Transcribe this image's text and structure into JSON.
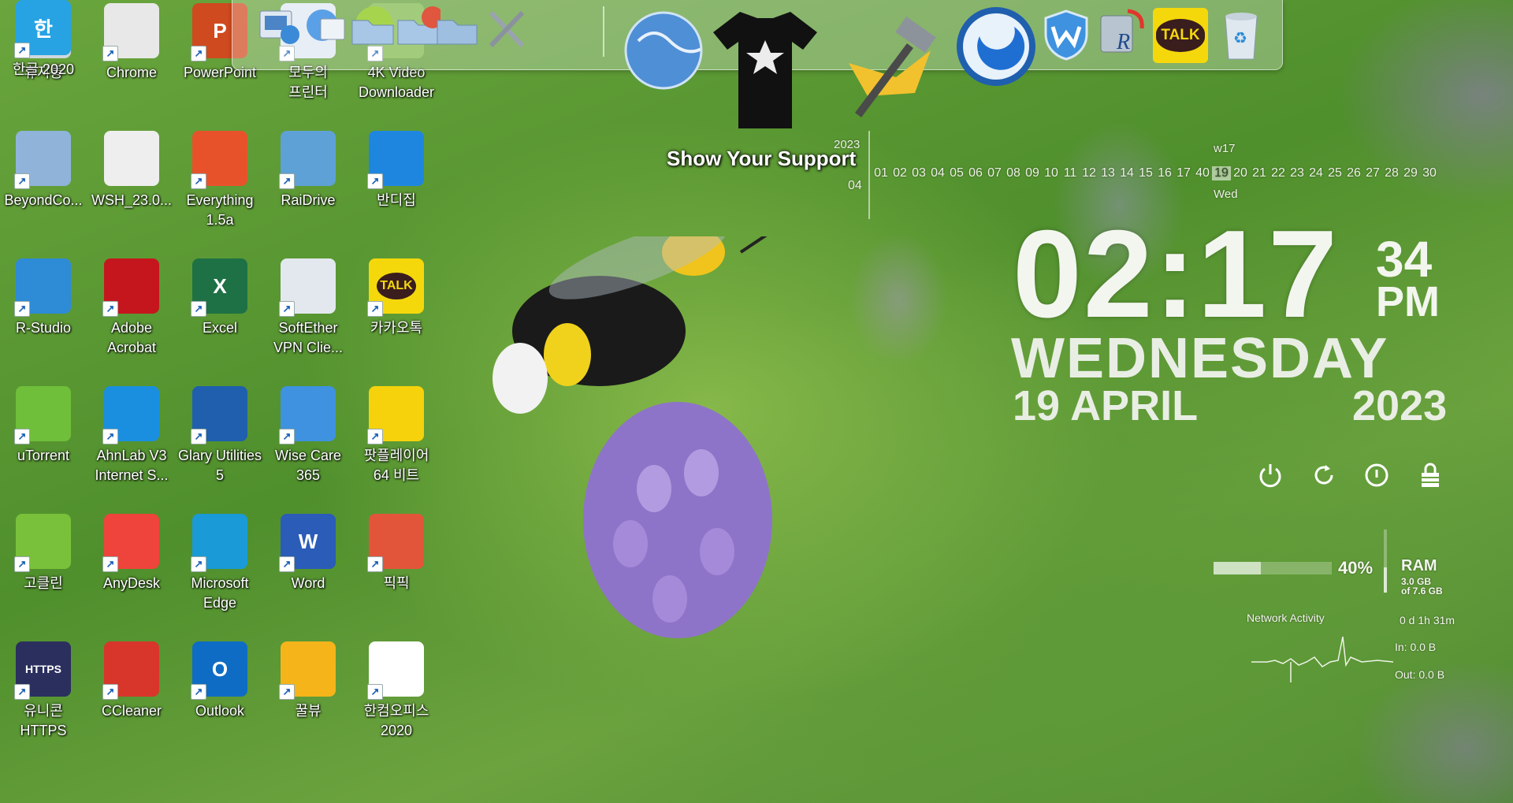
{
  "desktop_icons": [
    {
      "label": "휴지통",
      "icon": "recycle-bin-icon"
    },
    {
      "label": "Chrome",
      "icon": "chrome-icon"
    },
    {
      "label": "PowerPoint",
      "icon": "powerpoint-icon"
    },
    {
      "label": "모두의\n프린터",
      "icon": "printer-icon"
    },
    {
      "label": "4K Video\nDownloader",
      "icon": "video-downloader-icon"
    },
    {
      "label": "BeyondCo...",
      "icon": "beyond-compare-icon"
    },
    {
      "label": "WSH_23.0...",
      "icon": "disk-image-icon"
    },
    {
      "label": "Everything\n1.5a",
      "icon": "everything-search-icon"
    },
    {
      "label": "RaiDrive",
      "icon": "raidrive-icon"
    },
    {
      "label": "반디집",
      "icon": "bandizip-icon"
    },
    {
      "label": "R-Studio",
      "icon": "r-studio-icon"
    },
    {
      "label": "Adobe\nAcrobat",
      "icon": "acrobat-icon"
    },
    {
      "label": "Excel",
      "icon": "excel-icon"
    },
    {
      "label": "SoftEther\nVPN Clie...",
      "icon": "softether-icon"
    },
    {
      "label": "카카오톡",
      "icon": "kakaotalk-icon"
    },
    {
      "label": "uTorrent",
      "icon": "utorrent-icon"
    },
    {
      "label": "AhnLab V3\nInternet S...",
      "icon": "ahnlab-icon"
    },
    {
      "label": "Glary Utilities\n5",
      "icon": "glary-icon"
    },
    {
      "label": "Wise Care\n365",
      "icon": "wisecare-icon"
    },
    {
      "label": "팟플레이어\n64 비트",
      "icon": "potplayer-icon"
    },
    {
      "label": "고클린",
      "icon": "goclean-icon"
    },
    {
      "label": "AnyDesk",
      "icon": "anydesk-icon"
    },
    {
      "label": "Microsoft\nEdge",
      "icon": "edge-icon"
    },
    {
      "label": "Word",
      "icon": "word-icon"
    },
    {
      "label": "픽픽",
      "icon": "picpick-icon"
    },
    {
      "label": "유니콘\nHTTPS",
      "icon": "unicorn-https-icon"
    },
    {
      "label": "CCleaner",
      "icon": "ccleaner-icon"
    },
    {
      "label": "Outlook",
      "icon": "outlook-icon"
    },
    {
      "label": "꿀뷰",
      "icon": "honeyview-icon"
    },
    {
      "label": "한컴오피스\n2020",
      "icon": "hancom-office-icon"
    },
    {
      "label": "한글 2020",
      "icon": "hangul-icon"
    }
  ],
  "icon_texts": {
    "powerpoint": "P",
    "excel": "X",
    "word": "W",
    "outlook": "O",
    "kakao": "TALK",
    "https": "HTTPS",
    "hangul": "한"
  },
  "dock": {
    "support_text": "Show Your Support",
    "items": [
      "printer-dock-icon",
      "network-dock-icon",
      "folder-dock-icon",
      "folder-dock-icon",
      "folder-dock-icon",
      "tools-dock-icon",
      "globe-dock-icon",
      "tshirt-dock-icon",
      "hammer-dock-icon",
      "glary-dock-icon",
      "wisecare-dock-icon",
      "r-studio-dock-icon",
      "kakaotalk-dock-icon",
      "recycle-bin-dock-icon"
    ],
    "kakao_text": "TALK"
  },
  "calendar": {
    "year": "2023",
    "week": "w17",
    "month": "04",
    "days": [
      "01",
      "02",
      "03",
      "04",
      "05",
      "06",
      "07",
      "08",
      "09",
      "10",
      "11",
      "12",
      "13",
      "14",
      "15",
      "16",
      "17",
      "40",
      "19",
      "20",
      "21",
      "22",
      "23",
      "24",
      "25",
      "26",
      "27",
      "28",
      "29",
      "30"
    ],
    "today_index": 18,
    "today_weekday": "Wed"
  },
  "clock": {
    "time": "02:17",
    "seconds": "34",
    "ampm": "PM",
    "weekday": "WEDNESDAY",
    "date": "19 APRIL",
    "year": "2023"
  },
  "power_buttons": [
    "power-icon",
    "restart-icon",
    "sleep-icon",
    "lock-icon"
  ],
  "system": {
    "ram_percent": "40%",
    "ram_fraction": 0.4,
    "ram_label": "RAM",
    "ram_used": "3.0 GB",
    "ram_total": "of 7.6 GB",
    "network_label": "Network Activity",
    "uptime": "0 d 1h 31m",
    "net_in": "In: 0.0 B",
    "net_out": "Out: 0.0 B"
  },
  "colors": {
    "label_text": "#ffffff",
    "widget_text": "#eef3e6",
    "dock_bg": "rgba(255,255,255,0.28)"
  }
}
